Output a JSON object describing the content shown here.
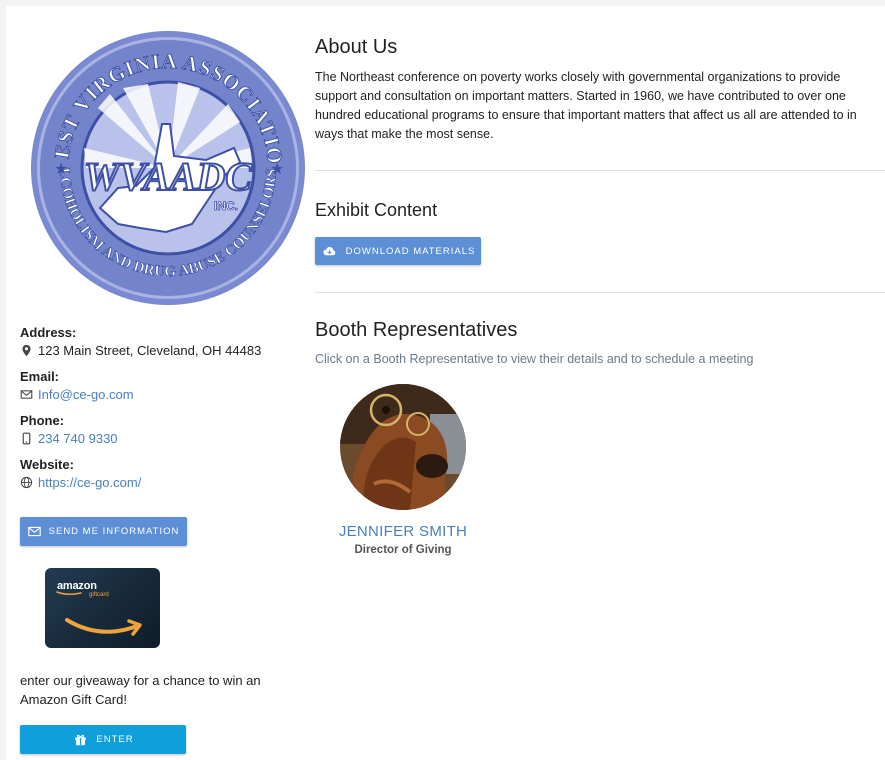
{
  "logo": {
    "org_ring_text": "WEST VIRGINIA ASSOCIATION OF ALCOHOLISM AND DRUG ABUSE COUNSELORS, INC",
    "acronym": "WVAADC",
    "suffix": "INC.",
    "icon": "wvaadc-logo-icon",
    "colors": {
      "ring": "#6f7fc7",
      "light": "#c6cdec",
      "dark": "#3e4fa6"
    }
  },
  "contact": {
    "address_label": "Address:",
    "address_value": "123 Main Street, Cleveland, OH 44483",
    "address_icon": "location-pin-icon",
    "email_label": "Email:",
    "email_value": "Info@ce-go.com",
    "email_icon": "envelope-icon",
    "phone_label": "Phone:",
    "phone_value": "234 740 9330",
    "phone_icon": "phone-icon",
    "website_label": "Website:",
    "website_value": "https://ce-go.com/",
    "website_icon": "globe-icon"
  },
  "send_info_button": {
    "label": "SEND ME INFORMATION",
    "icon": "envelope-icon",
    "color": "#5c8fd6"
  },
  "giftcard": {
    "brand": "amazon",
    "sub": "giftcard",
    "icon": "amazon-smile-icon"
  },
  "giveaway": {
    "text": "enter our giveaway for a chance to win an Amazon Gift Card!",
    "button_label": "ENTER",
    "button_icon": "gift-icon",
    "button_color": "#0fa0dc"
  },
  "about": {
    "title": "About Us",
    "body": "The Northeast conference on poverty works closely with governmental organizations to provide support and consultation on important matters. Started in 1960, we have contributed to over one hundred educational programs to ensure that important matters that affect us all are attended to in ways that make the most sense."
  },
  "exhibit": {
    "title": "Exhibit Content",
    "download_label": "DOWNLOAD MATERIALS",
    "download_icon": "cloud-download-icon"
  },
  "booth": {
    "title": "Booth Representatives",
    "subtitle": "Click on a Booth Representative to view their details and to schedule a meeting",
    "reps": [
      {
        "name": "JENNIFER SMITH",
        "role": "Director of Giving",
        "avatar": "dog-with-glasses-photo"
      }
    ]
  },
  "colors": {
    "accent": "#4a7fc1",
    "link": "#4a7fc1",
    "subtle": "#6a7a8a"
  }
}
